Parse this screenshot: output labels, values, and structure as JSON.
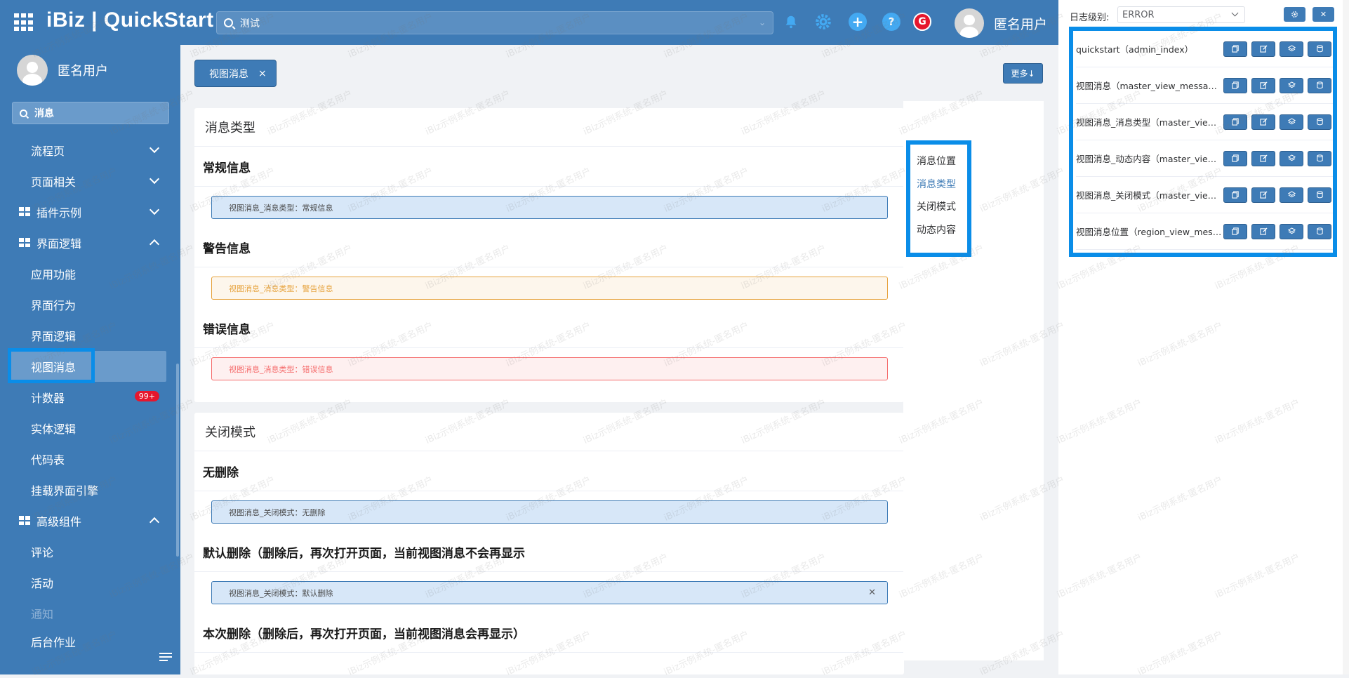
{
  "header": {
    "logo": "iBiz | QuickStart",
    "search_value": "测试",
    "user_name": "匿名用户",
    "icons": [
      "bell-icon",
      "gear-icon",
      "plus-icon",
      "help-icon",
      "g-logo-icon"
    ]
  },
  "sidebar": {
    "user_name": "匿名用户",
    "search_value": "消息",
    "items": [
      {
        "label": "流程页",
        "type": "sub",
        "chevron": "down"
      },
      {
        "label": "页面相关",
        "type": "sub",
        "chevron": "down"
      },
      {
        "label": "插件示例",
        "type": "group",
        "chevron": "down"
      },
      {
        "label": "界面逻辑",
        "type": "group",
        "chevron": "up"
      },
      {
        "label": "应用功能",
        "type": "sub"
      },
      {
        "label": "界面行为",
        "type": "sub"
      },
      {
        "label": "界面逻辑",
        "type": "sub"
      },
      {
        "label": "视图消息",
        "type": "sub",
        "active": true
      },
      {
        "label": "计数器",
        "type": "sub",
        "badge": "99+"
      },
      {
        "label": "实体逻辑",
        "type": "sub"
      },
      {
        "label": "代码表",
        "type": "sub"
      },
      {
        "label": "挂载界面引擎",
        "type": "sub"
      },
      {
        "label": "高级组件",
        "type": "group",
        "chevron": "up"
      },
      {
        "label": "评论",
        "type": "sub"
      },
      {
        "label": "活动",
        "type": "sub"
      },
      {
        "label": "通知",
        "type": "sub",
        "dim": true
      },
      {
        "label": "后台作业",
        "type": "sub"
      }
    ]
  },
  "main": {
    "tab_label": "视图消息",
    "more_label": "更多↓",
    "card1": {
      "title": "消息类型",
      "sections": [
        {
          "heading": "常规信息",
          "message": "视图消息_消息类型：常规信息",
          "kind": "info"
        },
        {
          "heading": "警告信息",
          "message": "视图消息_消息类型：警告信息",
          "kind": "warn"
        },
        {
          "heading": "错误信息",
          "message": "视图消息_消息类型：错误信息",
          "kind": "err"
        }
      ]
    },
    "card2": {
      "title": "关闭模式",
      "sections": [
        {
          "heading": "无删除",
          "message": "视图消息_关闭模式：无删除",
          "kind": "info",
          "closable": false
        },
        {
          "heading": "默认删除（删除后，再次打开页面，当前视图消息不会再显示",
          "message": "视图消息_关闭模式：默认删除",
          "kind": "info",
          "closable": true
        },
        {
          "heading": "本次删除（删除后，再次打开页面，当前视图消息会再显示）"
        }
      ]
    },
    "anchors": [
      "消息位置",
      "消息类型",
      "关闭模式",
      "动态内容"
    ],
    "anchor_active": "消息类型"
  },
  "debug_panel": {
    "log_label": "日志级别:",
    "log_level": "ERROR",
    "views": [
      "quickstart（admin_index）",
      "视图消息（master_view_message）",
      "视图消息_消息类型（master_view_message_type）",
      "视图消息_动态内容（master_view_message_dynamic）",
      "视图消息_关闭模式（master_view_message_close）",
      "视图消息位置（region_view_message）"
    ]
  },
  "watermark": "iBiz示例系统-匿名用户",
  "colors": {
    "primary": "#3e7bb6",
    "highlight": "#0a8de8",
    "warning": "#e6a23c",
    "error": "#f56c6c",
    "badge": "#e6162d"
  }
}
